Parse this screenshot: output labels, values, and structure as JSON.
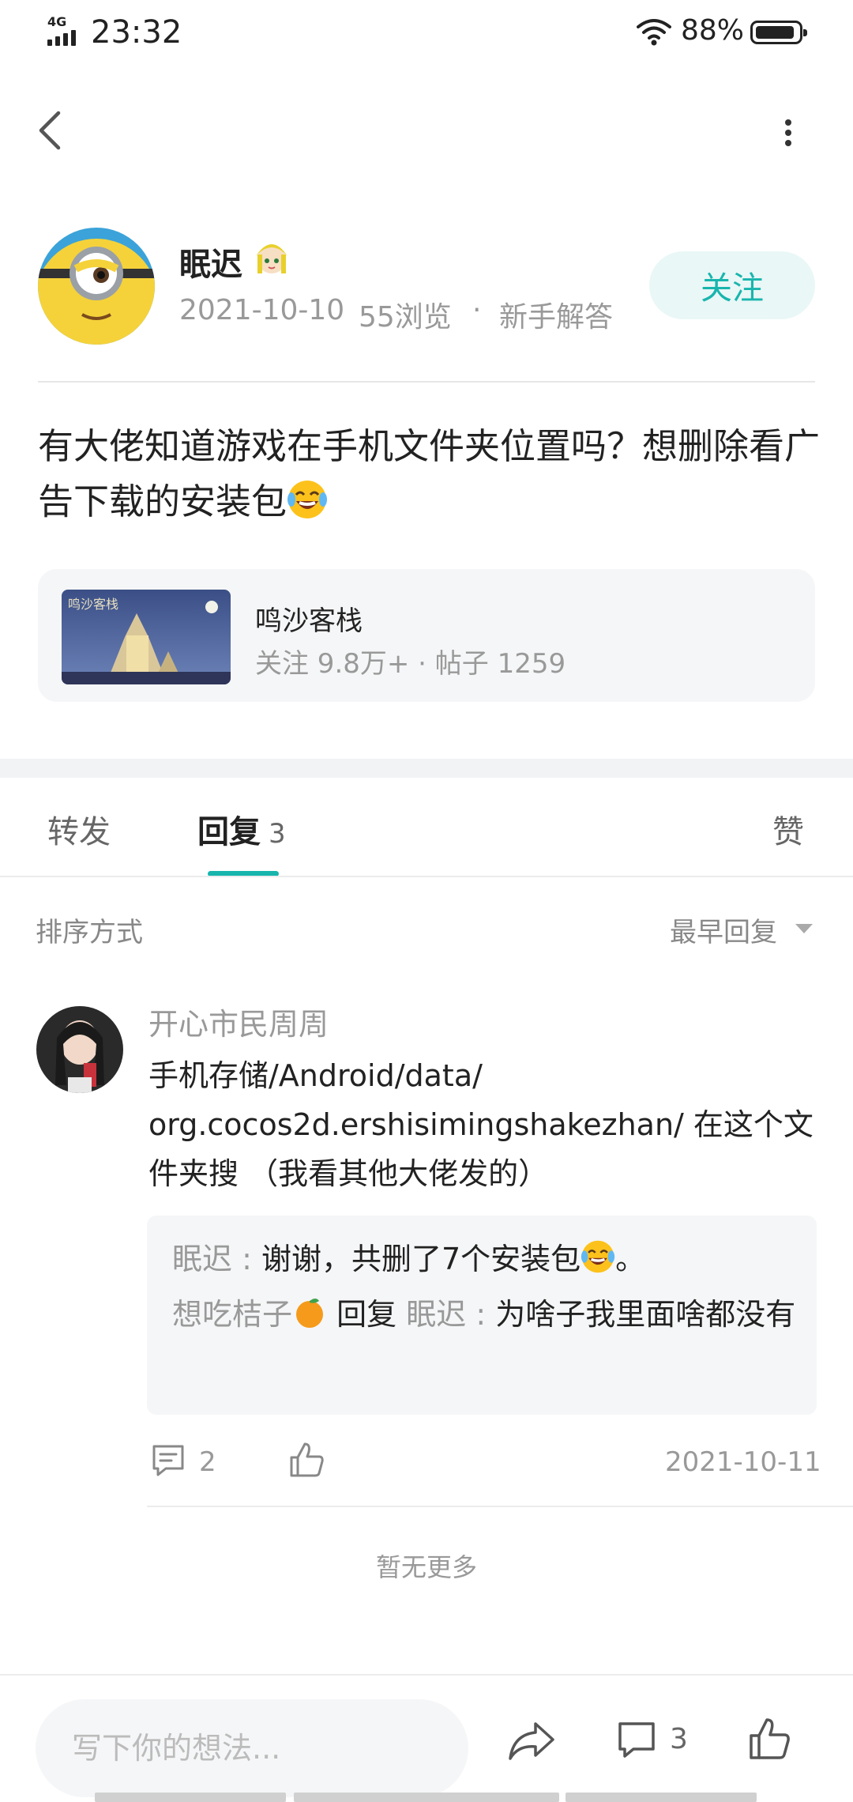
{
  "status_bar": {
    "network": "4G",
    "time": "23:32",
    "battery": "88%",
    "icons": [
      "signal-icon",
      "wifi-icon",
      "battery-icon"
    ]
  },
  "nav": {
    "back_icon": "back-arrow-icon",
    "more_icon": "more-vertical-icon"
  },
  "author": {
    "name": "眠迟",
    "badge_icon": "user-badge-icon",
    "date": "2021-10-10",
    "views": "55浏览",
    "separator": "·",
    "tag": "新手解答",
    "follow_label": "关注"
  },
  "post": {
    "text": "有大佬知道游戏在手机文件夹位置吗？想删除看广告下载的安装包",
    "emoji": "laughing-tears-emoji"
  },
  "game": {
    "name": "鸣沙客栈",
    "stats": "关注 9.8万+ · 帖子 1259"
  },
  "tabs": {
    "forward": "转发",
    "reply": "回复",
    "reply_count": "3",
    "like": "赞"
  },
  "sort": {
    "label": "排序方式",
    "value": "最早回复"
  },
  "comments": [
    {
      "user": "开心市民周周",
      "body": "手机存储/Android/data/ org.cocos2d.ershisimingshakezhan/ 在这个文件夹搜 （我看其他大佬发的）",
      "replies": [
        {
          "user": "眠迟",
          "text": "谢谢，共删了7个安装包",
          "suffix": "。"
        },
        {
          "user": "想吃桔子",
          "reply_word": "回复",
          "reply_to": "眠迟",
          "text": "为啥子我里面啥都没有"
        }
      ],
      "reply_count": "2",
      "date": "2021-10-11"
    }
  ],
  "no_more": "暂无更多",
  "bottom_bar": {
    "placeholder": "写下你的想法...",
    "comment_count": "3"
  },
  "colors": {
    "accent": "#18b5ad",
    "follow_bg": "#e9f7f6",
    "muted": "#999999"
  }
}
